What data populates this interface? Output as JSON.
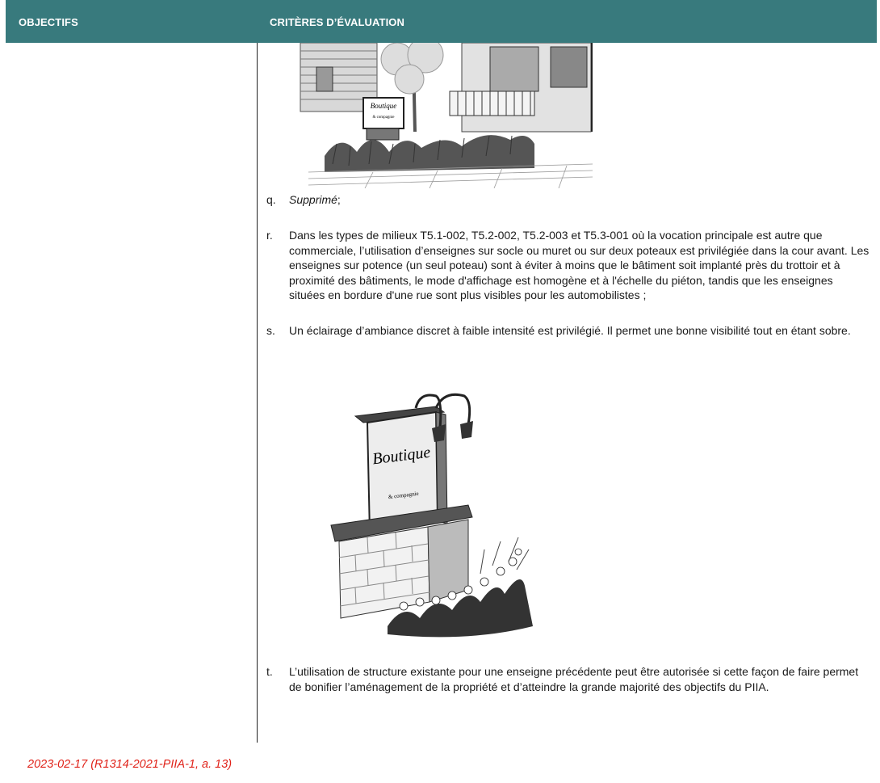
{
  "header": {
    "col_objectifs": "OBJECTIFS",
    "col_criteres": "CRITÈRES D’ÉVALUATION"
  },
  "items": {
    "q": {
      "letter": "q.",
      "text_italic": "Supprimé",
      "text_suffix": ";"
    },
    "r": {
      "letter": "r.",
      "text": "Dans les types de milieux T5.1-002, T5.2-002, T5.2-003 et T5.3-001 où la vocation principale est autre que commerciale, l’utilisation d’enseignes sur socle ou muret ou sur deux poteaux est privilégiée dans la cour avant. Les enseignes sur potence (un seul poteau) sont à éviter à moins que le bâtiment soit implanté près du trottoir et à proximité des bâtiments, le mode d'affichage est homogène et à l'échelle du piéton, tandis que les enseignes situées en bordure d'une rue sont plus visibles pour les automobilistes ;"
    },
    "s": {
      "letter": "s.",
      "text": "Un éclairage d’ambiance discret à faible intensité est privilégié. Il permet une bonne visibilité tout en étant sobre."
    },
    "t": {
      "letter": "t.",
      "text": "L’utilisation de structure existante pour une enseigne précédente peut être autorisée si cette façon de faire permet de bonifier l’aménagement de la propriété et d’atteindre la grande majorité des objectifs du PIIA."
    }
  },
  "illustrations": {
    "sign1": {
      "sign_word": "Boutique",
      "sign_small": "& compagnie"
    },
    "sign2": {
      "sign_word": "Boutique",
      "sign_small": "& compagnie"
    }
  },
  "footer": {
    "note": "2023-02-17 (R1314-2021-PIIA-1, a. 13)"
  }
}
